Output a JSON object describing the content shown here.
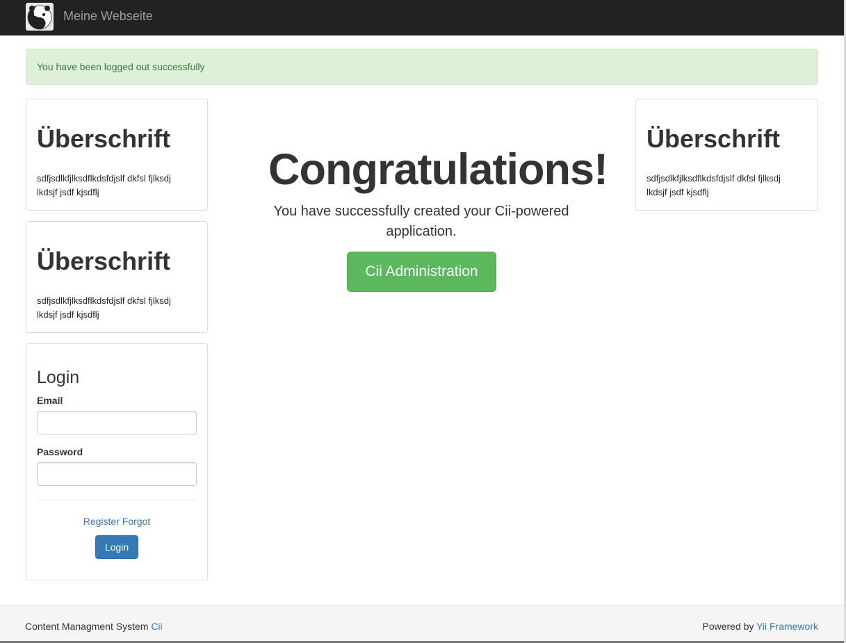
{
  "navbar": {
    "brand": "Meine Webseite",
    "logo_icon": "panda-logo-icon"
  },
  "alert": {
    "text": "You have been logged out successfully"
  },
  "left_panels": [
    {
      "heading": "Überschrift",
      "text": "sdfjsdlkfjlksdflkdsfdjslf dkfsl fjlksdj lkdsjf jsdf kjsdflj"
    },
    {
      "heading": "Überschrift",
      "text": "sdfjsdlkfjlksdflkdsfdjslf dkfsl fjlksdj lkdsjf jsdf kjsdflj"
    }
  ],
  "right_panel": {
    "heading": "Überschrift",
    "text": "sdfjsdlkfjlksdflkdsfdjslf dkfsl fjlksdj lkdsjf jsdf kjsdflj"
  },
  "hero": {
    "title": "Congratulations!",
    "text": "You have successfully created your Cii-powered application.",
    "button": "Cii Administration"
  },
  "login": {
    "title": "Login",
    "email_label": "Email",
    "email_value": "",
    "password_label": "Password",
    "password_value": "",
    "register_link": "Register",
    "forgot_link": "Forgot",
    "button": "Login"
  },
  "footer": {
    "left_text": "Content Managment System",
    "left_link": "Cii",
    "right_text": "Powered by",
    "right_link": "Yii Framework"
  },
  "colors": {
    "navbar_bg": "#222222",
    "alert_bg": "#dff0d8",
    "alert_text": "#3c763d",
    "primary": "#337ab7",
    "success": "#5cb85c",
    "footer_bg": "#f5f5f5"
  }
}
